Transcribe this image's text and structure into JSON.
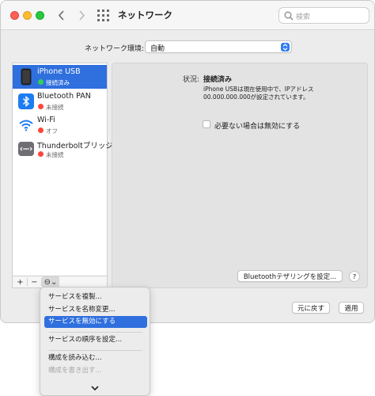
{
  "window": {
    "title": "ネットワーク"
  },
  "search": {
    "placeholder": "検索"
  },
  "location": {
    "label": "ネットワーク環境:",
    "value": "自動"
  },
  "services": [
    {
      "name": "iPhone USB",
      "status": "接続済み",
      "status_color": "#30d158",
      "icon": "iphone-icon",
      "selected": true
    },
    {
      "name": "Bluetooth PAN",
      "status": "未接続",
      "status_color": "#ff453a",
      "icon": "bluetooth-icon",
      "selected": false
    },
    {
      "name": "Wi-Fi",
      "status": "オフ",
      "status_color": "#ff453a",
      "icon": "wifi-icon",
      "selected": false
    },
    {
      "name": "Thunderboltブリッジ",
      "status": "未接続",
      "status_color": "#ff453a",
      "icon": "thunderbolt-icon",
      "selected": false
    }
  ],
  "sidebar_toolbar": {
    "add": "+",
    "remove": "−",
    "action": "⊖⌄"
  },
  "detail": {
    "status_label": "状況:",
    "status_value": "接続済み",
    "description": "iPhone USBは現在使用中で、IPアドレス 00.000.000.000が設定されています。",
    "checkbox_label": "必要ない場合は無効にする",
    "checkbox_checked": false,
    "tether_button": "Bluetoothテザリングを設定...",
    "help": "?"
  },
  "footer": {
    "revert": "元に戻す",
    "apply": "適用"
  },
  "menu": {
    "items": [
      {
        "label": "サービスを複製...",
        "enabled": true,
        "highlighted": false
      },
      {
        "label": "サービスを名称変更...",
        "enabled": true,
        "highlighted": false
      },
      {
        "label": "サービスを無効にする",
        "enabled": true,
        "highlighted": true
      },
      {
        "label": "サービスの順序を設定...",
        "enabled": true,
        "highlighted": false
      },
      {
        "label": "構成を読み込む...",
        "enabled": true,
        "highlighted": false
      },
      {
        "label": "構成を書き出す...",
        "enabled": false,
        "highlighted": false
      }
    ]
  },
  "colors": {
    "accent": "#2f6fde",
    "selection": "#2f6fde"
  }
}
